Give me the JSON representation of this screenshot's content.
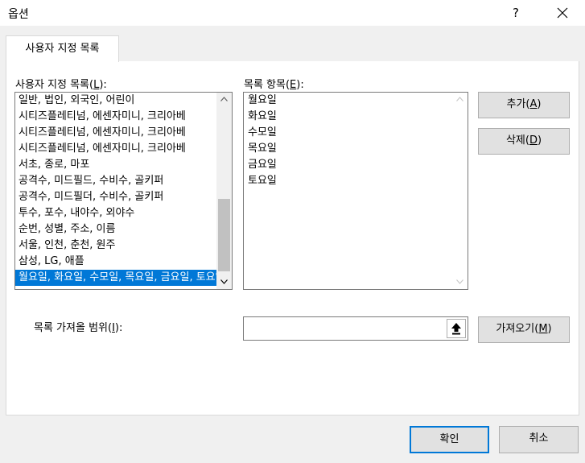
{
  "window": {
    "title": "옵션",
    "help_label": "?",
    "close_icon": "close-icon"
  },
  "tab": {
    "label": "사용자 지정 목록"
  },
  "custom_lists": {
    "label_text": "사용자 지정 목록(",
    "label_key": "L",
    "label_end": "):",
    "items": [
      "일반, 법인, 외국인, 어린이",
      "시티즈플레티넘, 에센자미니, 크리아베",
      "시티즈플레티넘, 에센자미니, 크리아베",
      "시티즈플레티넘, 에센자미니, 크리아베",
      "서초, 종로, 마포",
      "공격수, 미드필드, 수비수, 골키퍼",
      "공격수, 미드필더, 수비수, 골키퍼",
      "투수, 포수, 내야수, 외야수",
      "순번, 성별, 주소, 이름",
      "서울, 인천, 춘천, 원주",
      "삼성, LG, 애플",
      "월요일, 화요일, 수모일, 목요일, 금요일, 토요일"
    ],
    "selected_index": 11
  },
  "list_entries": {
    "label_text": "목록 항목(",
    "label_key": "E",
    "label_end": "):",
    "items": [
      "월요일",
      "화요일",
      "수모일",
      "목요일",
      "금요일",
      "토요일"
    ]
  },
  "buttons": {
    "add_text": "추가(",
    "add_key": "A",
    "add_end": ")",
    "delete_text": "삭제(",
    "delete_key": "D",
    "delete_end": ")",
    "import_text": "가져오기(",
    "import_key": "M",
    "import_end": ")",
    "ok": "확인",
    "cancel": "취소"
  },
  "import_range": {
    "label_text": "목록 가져올 범위(",
    "label_key": "I",
    "label_end": "):",
    "value": ""
  },
  "colors": {
    "selection": "#0078d7",
    "ok_border": "#0078d7"
  }
}
